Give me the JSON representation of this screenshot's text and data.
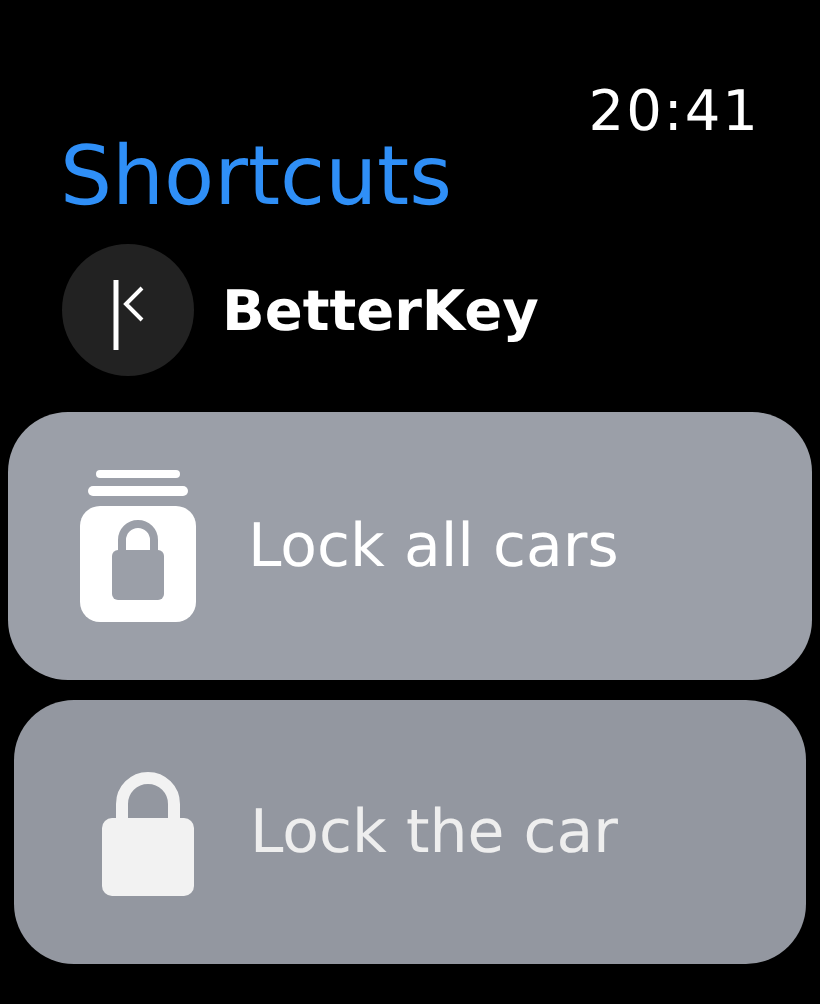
{
  "status_bar": {
    "time": "20:41"
  },
  "title": "Shortcuts",
  "app": {
    "name": "BetterKey"
  },
  "shortcuts": [
    {
      "kind": "lock-stack",
      "label": "Lock all cars"
    },
    {
      "kind": "lock",
      "label": "Lock the car"
    }
  ]
}
